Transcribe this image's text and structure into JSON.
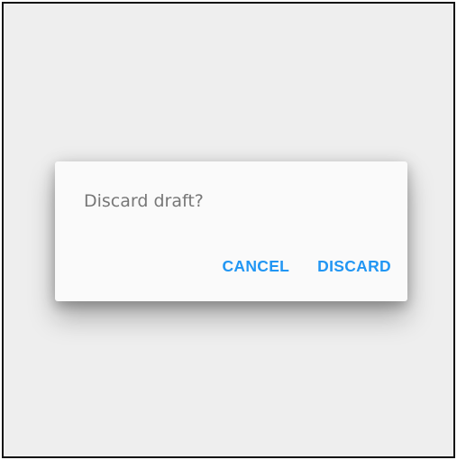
{
  "dialog": {
    "message": "Discard draft?",
    "actions": {
      "cancel_label": "CANCEL",
      "discard_label": "DISCARD"
    }
  },
  "colors": {
    "accent": "#2196f3",
    "background": "#eeeeee",
    "dialog_surface": "#fafafa",
    "message_text": "#777777"
  }
}
